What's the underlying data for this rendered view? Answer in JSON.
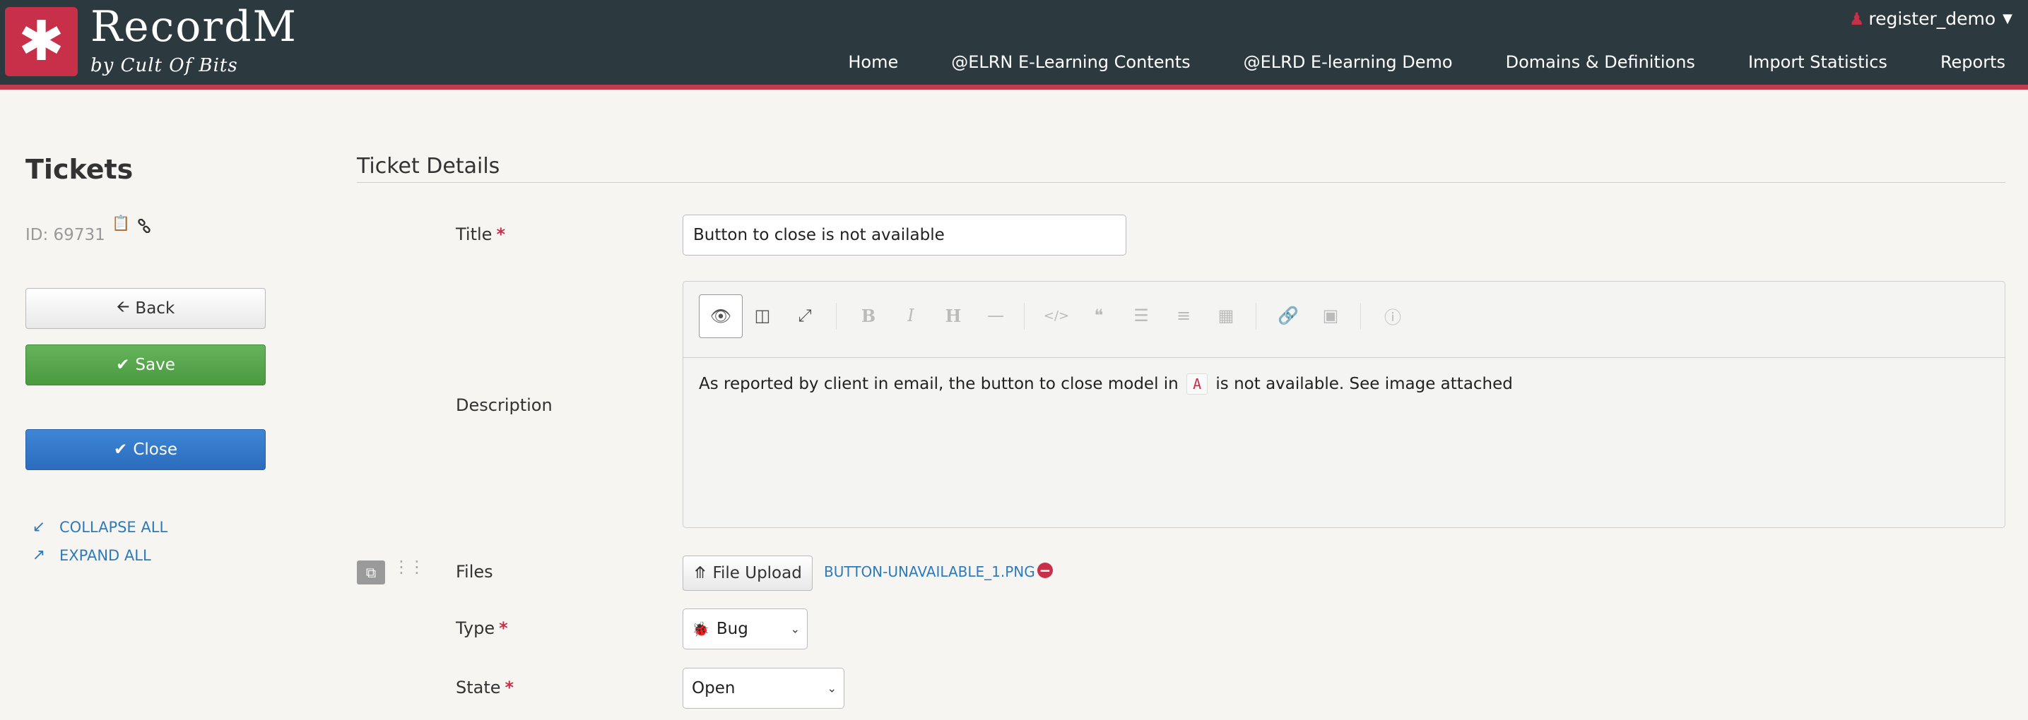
{
  "app": {
    "name": "RecordM",
    "subtitle": "by Cult Of Bits",
    "logo_glyph": "✱"
  },
  "header": {
    "user": "register_demo",
    "nav": [
      {
        "label": "Home"
      },
      {
        "label": "@ELRN E-Learning Contents"
      },
      {
        "label": "@ELRD E-learning Demo"
      },
      {
        "label": "Domains & Definitions"
      },
      {
        "label": "Import Statistics"
      },
      {
        "label": "Reports"
      }
    ]
  },
  "sidebar": {
    "title": "Tickets",
    "record_id": "ID: 69731",
    "back_label": "Back",
    "save_label": "Save",
    "close_label": "Close",
    "collapse_label": "COLLAPSE ALL",
    "expand_label": "EXPAND ALL"
  },
  "form": {
    "section_title": "Ticket Details",
    "title_label": "Title",
    "title_value": "Button to close is not available",
    "description_label": "Description",
    "description_before": "As reported by client in email, the button to close model in",
    "description_code": "A",
    "description_after": "is not available. See image attached",
    "files_label": "Files",
    "upload_label": "File Upload",
    "file_name": "BUTTON-UNAVAILABLE_1.PNG",
    "type_label": "Type",
    "type_value": "Bug",
    "state_label": "State",
    "state_value": "Open"
  },
  "colors": {
    "header_bg": "#2c3a40",
    "brand_red": "#c8304a",
    "save_green": "#4a9a40",
    "close_blue": "#2c6cbd",
    "link_blue": "#2b7bbd"
  }
}
